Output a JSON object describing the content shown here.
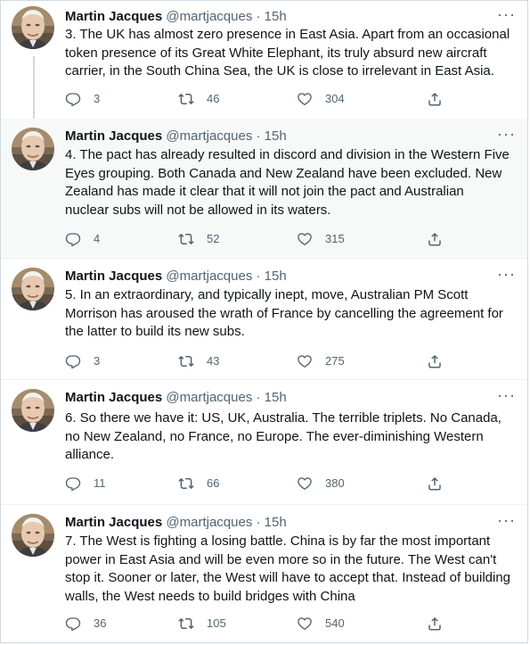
{
  "author": {
    "name": "Martin Jacques",
    "handle": "@martjacques"
  },
  "separator": "·",
  "more_glyph": "···",
  "tweets": [
    {
      "time": "15h",
      "text": "3. The UK has almost zero presence in East Asia. Apart from an occasional token presence of its Great White Elephant, its truly absurd new aircraft carrier, in the South China Sea, the UK is close to irrelevant in East Asia.",
      "replies": "3",
      "retweets": "46",
      "likes": "304"
    },
    {
      "time": "15h",
      "text": "4. The pact has already resulted in discord and division in the Western Five Eyes grouping. Both Canada and New Zealand have been excluded. New Zealand has made it clear that it will not join the pact and Australian nuclear subs will not be allowed in its waters.",
      "replies": "4",
      "retweets": "52",
      "likes": "315"
    },
    {
      "time": "15h",
      "text": "5. In an extraordinary, and typically inept, move, Australian PM Scott Morrison has aroused the wrath of France by cancelling the agreement for the latter to build its new subs.",
      "replies": "3",
      "retweets": "43",
      "likes": "275"
    },
    {
      "time": "15h",
      "text": "6. So there we have it: US, UK, Australia. The terrible triplets. No Canada, no New Zealand, no France, no Europe. The ever-diminishing Western alliance.",
      "replies": "11",
      "retweets": "66",
      "likes": "380"
    },
    {
      "time": "15h",
      "text": "7. The West is fighting a losing battle. China is by far the most important power in East Asia and will be even more so in the future. The West can't stop it. Sooner or later, the West will have to accept that. Instead of building walls, the West needs to build bridges with China",
      "replies": "36",
      "retweets": "105",
      "likes": "540"
    }
  ]
}
